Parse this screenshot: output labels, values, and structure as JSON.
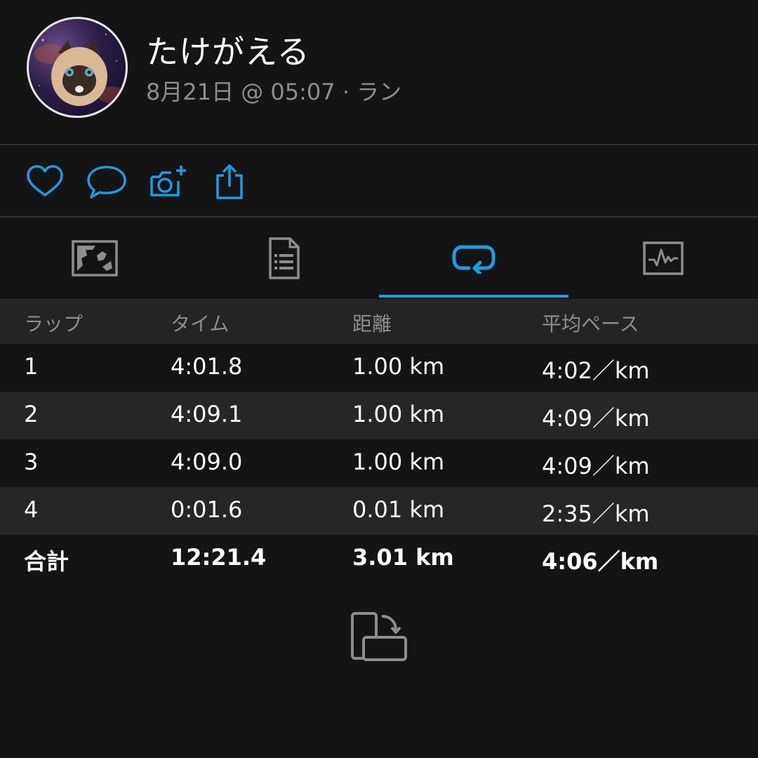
{
  "user": {
    "name": "たけがえる",
    "meta": "8月21日 @ 05:07 · ラン"
  },
  "actions": [
    {
      "icon": "heart-icon"
    },
    {
      "icon": "comment-icon"
    },
    {
      "icon": "add-photo-icon"
    },
    {
      "icon": "share-icon"
    }
  ],
  "tabs": [
    {
      "icon": "map-icon",
      "selected": false
    },
    {
      "icon": "details-icon",
      "selected": false
    },
    {
      "icon": "laps-icon",
      "selected": true
    },
    {
      "icon": "chart-icon",
      "selected": false
    }
  ],
  "colors": {
    "accent": "#1e9be6",
    "background": "#141414",
    "row_alt": "#262626",
    "header_bg": "#242424",
    "muted_text": "#8e8e8e"
  },
  "laps": {
    "headers": [
      "ラップ",
      "タイム",
      "距離",
      "平均ペース"
    ],
    "rows": [
      [
        "1",
        "4:01.8",
        "1.00 km",
        "4:02／km"
      ],
      [
        "2",
        "4:09.1",
        "1.00 km",
        "4:09／km"
      ],
      [
        "3",
        "4:09.0",
        "1.00 km",
        "4:09／km"
      ],
      [
        "4",
        "0:01.6",
        "0.01 km",
        "2:35／km"
      ]
    ],
    "total": [
      "合計",
      "12:21.4",
      "3.01 km",
      "4:06／km"
    ]
  },
  "rotate_icon": "rotate-screen-icon"
}
